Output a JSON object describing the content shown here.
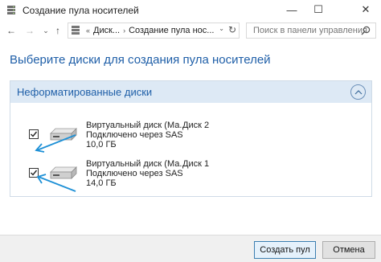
{
  "window": {
    "title": "Создание пула носителей",
    "minimize_glyph": "—",
    "maximize_glyph": "☐",
    "close_glyph": "✕"
  },
  "nav": {
    "back_glyph": "←",
    "forward_glyph": "→",
    "dropdown_glyph": "⌄",
    "up_glyph": "↑"
  },
  "address": {
    "overflow": "«",
    "segment1": "Диск...",
    "separator": "›",
    "segment2": "Создание пула нос...",
    "chevron": "⌄",
    "refresh_glyph": "↻"
  },
  "search": {
    "placeholder": "Поиск в панели управления"
  },
  "heading": "Выберите диски для создания пула носителей",
  "group": {
    "title": "Неформатированные диски",
    "collapse_glyph": "^",
    "disks": [
      {
        "name": "Виртуальный диск (Ма...",
        "connection": "Подключено через SAS",
        "size": "10,0 ГБ",
        "id": "Диск 2",
        "checked": true
      },
      {
        "name": "Виртуальный диск (Ма...",
        "connection": "Подключено через SAS",
        "size": "14,0 ГБ",
        "id": "Диск 1",
        "checked": true
      }
    ]
  },
  "buttons": {
    "create": "Создать пул",
    "cancel": "Отмена"
  },
  "colors": {
    "accent": "#1f5fa8",
    "group_header": "#dde9f5",
    "annotation_arrow": "#1e90d6"
  },
  "icons": [
    "storage-pool-app-icon",
    "drive-icon",
    "search-icon",
    "checkbox-checked-icon",
    "chevron-up-icon",
    "annotation-arrow"
  ]
}
